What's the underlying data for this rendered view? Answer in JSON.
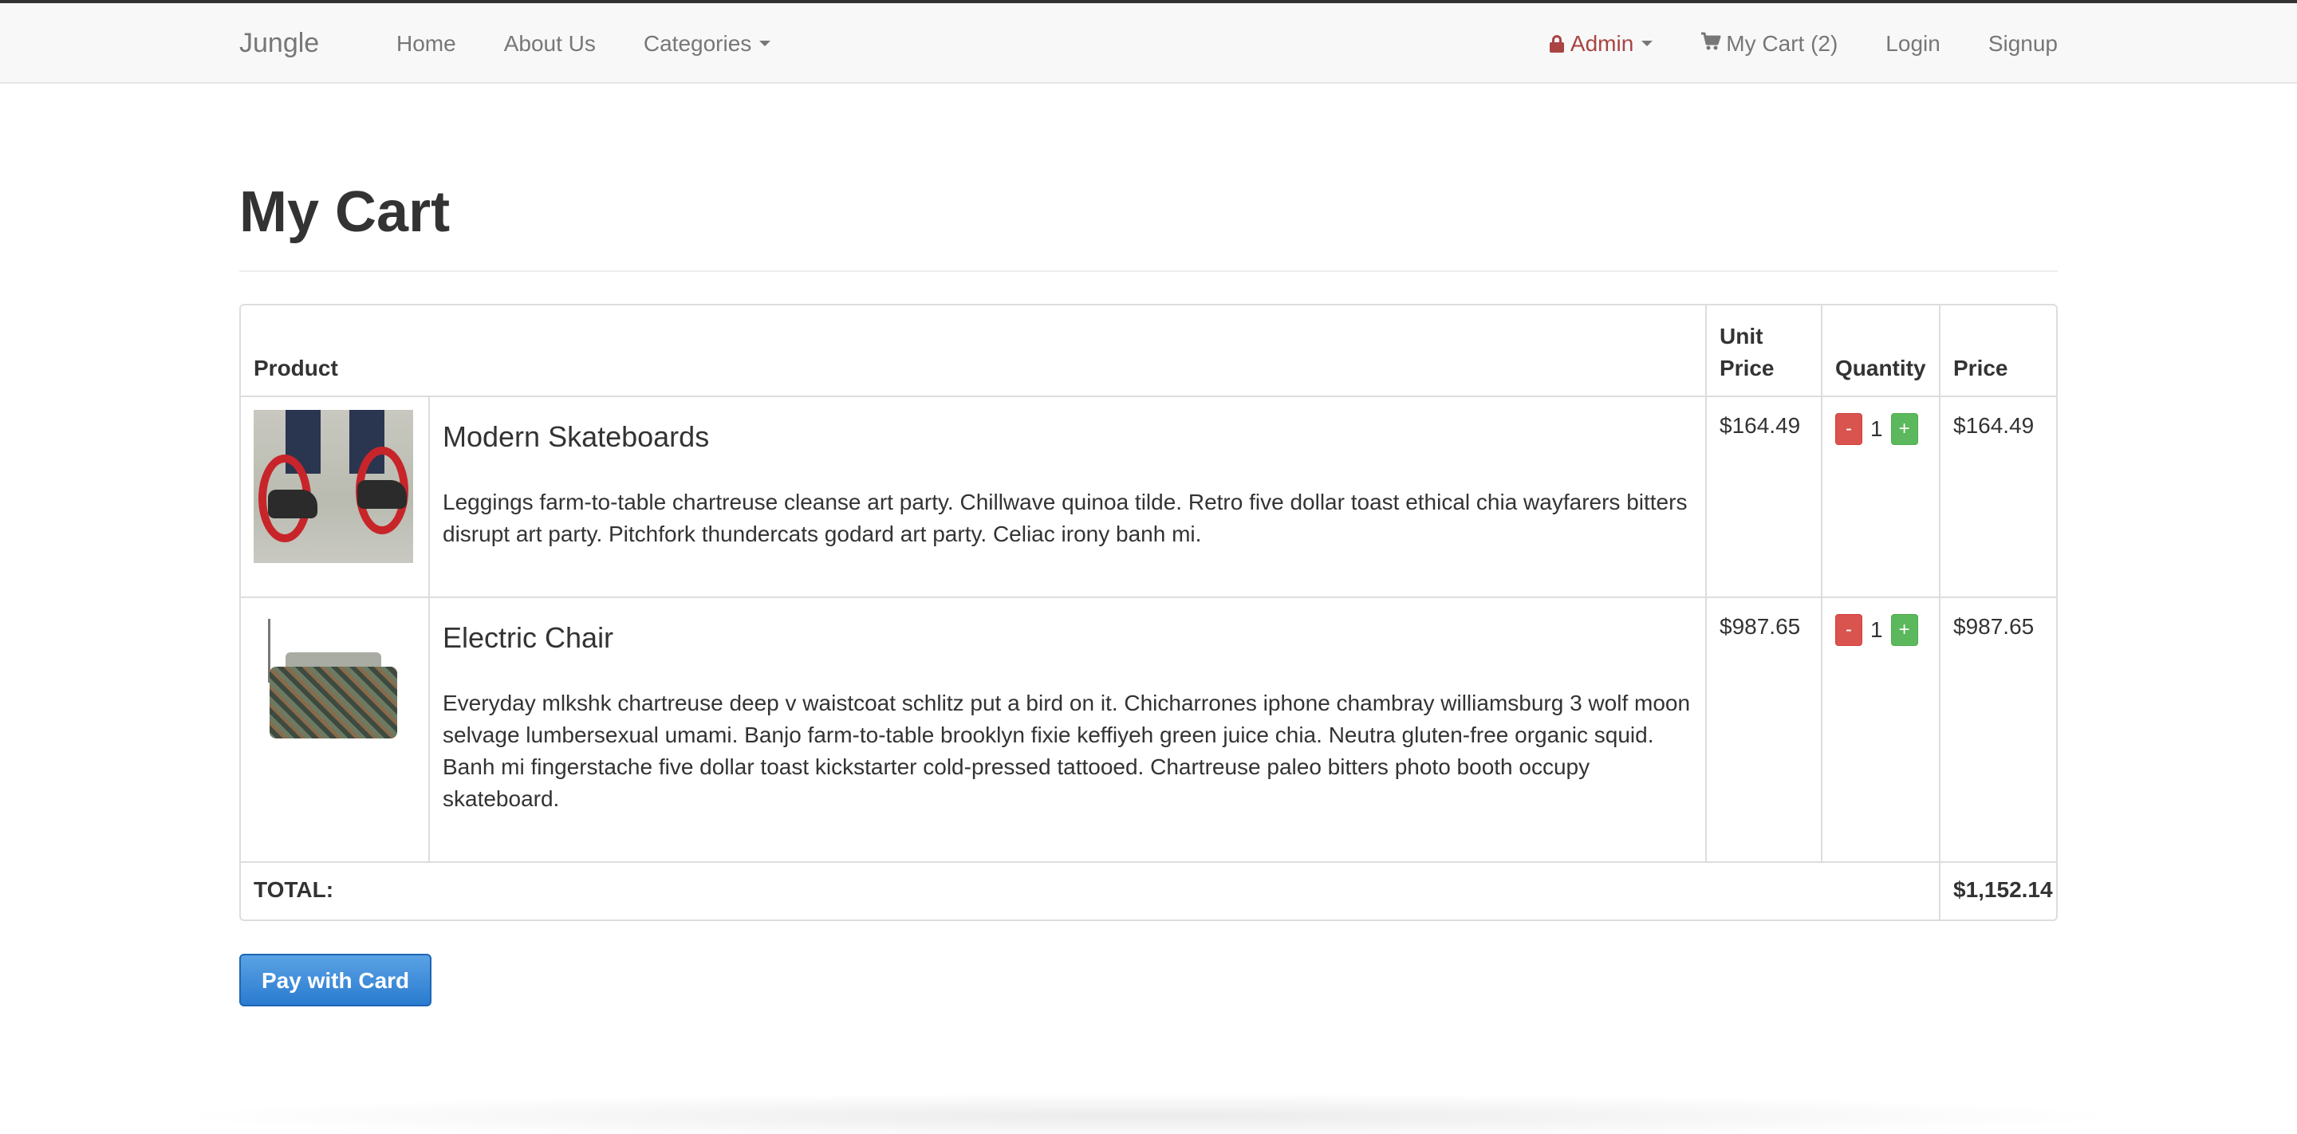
{
  "navbar": {
    "brand": "Jungle",
    "left": [
      {
        "label": "Home"
      },
      {
        "label": "About Us"
      },
      {
        "label": "Categories"
      }
    ],
    "admin_label": "Admin",
    "cart_label": "My Cart (2)",
    "login_label": "Login",
    "signup_label": "Signup"
  },
  "page": {
    "title": "My Cart"
  },
  "table": {
    "headers": {
      "product": "Product",
      "unit_price": "Unit Price",
      "quantity": "Quantity",
      "price": "Price"
    },
    "items": [
      {
        "name": "Modern Skateboards",
        "description": "Leggings farm-to-table chartreuse cleanse art party. Chillwave quinoa tilde. Retro five dollar toast ethical chia wayfarers bitters disrupt art party. Pitchfork thundercats godard art party. Celiac irony banh mi.",
        "unit_price": "$164.49",
        "minus": "-",
        "quantity": "1",
        "plus": "+",
        "price": "$164.49"
      },
      {
        "name": "Electric Chair",
        "description": "Everyday mlkshk chartreuse deep v waistcoat schlitz put a bird on it. Chicharrones iphone chambray williamsburg 3 wolf moon selvage lumbersexual umami. Banjo farm-to-table brooklyn fixie keffiyeh green juice chia. Neutra gluten-free organic squid. Banh mi fingerstache five dollar toast kickstarter cold-pressed tattooed. Chartreuse paleo bitters photo booth occupy skateboard.",
        "unit_price": "$987.65",
        "minus": "-",
        "quantity": "1",
        "plus": "+",
        "price": "$987.65"
      }
    ],
    "total_label": "TOTAL:",
    "total_value": "$1,152.14"
  },
  "actions": {
    "pay_label": "Pay with Card"
  },
  "icons": {
    "lock": "lock-icon",
    "cart": "shopping-cart-icon",
    "caret": "caret-down-icon"
  },
  "colors": {
    "admin": "#a94442",
    "minus_button": "#d9534f",
    "plus_button": "#5cb85c",
    "pay_button": "#337ab7"
  }
}
